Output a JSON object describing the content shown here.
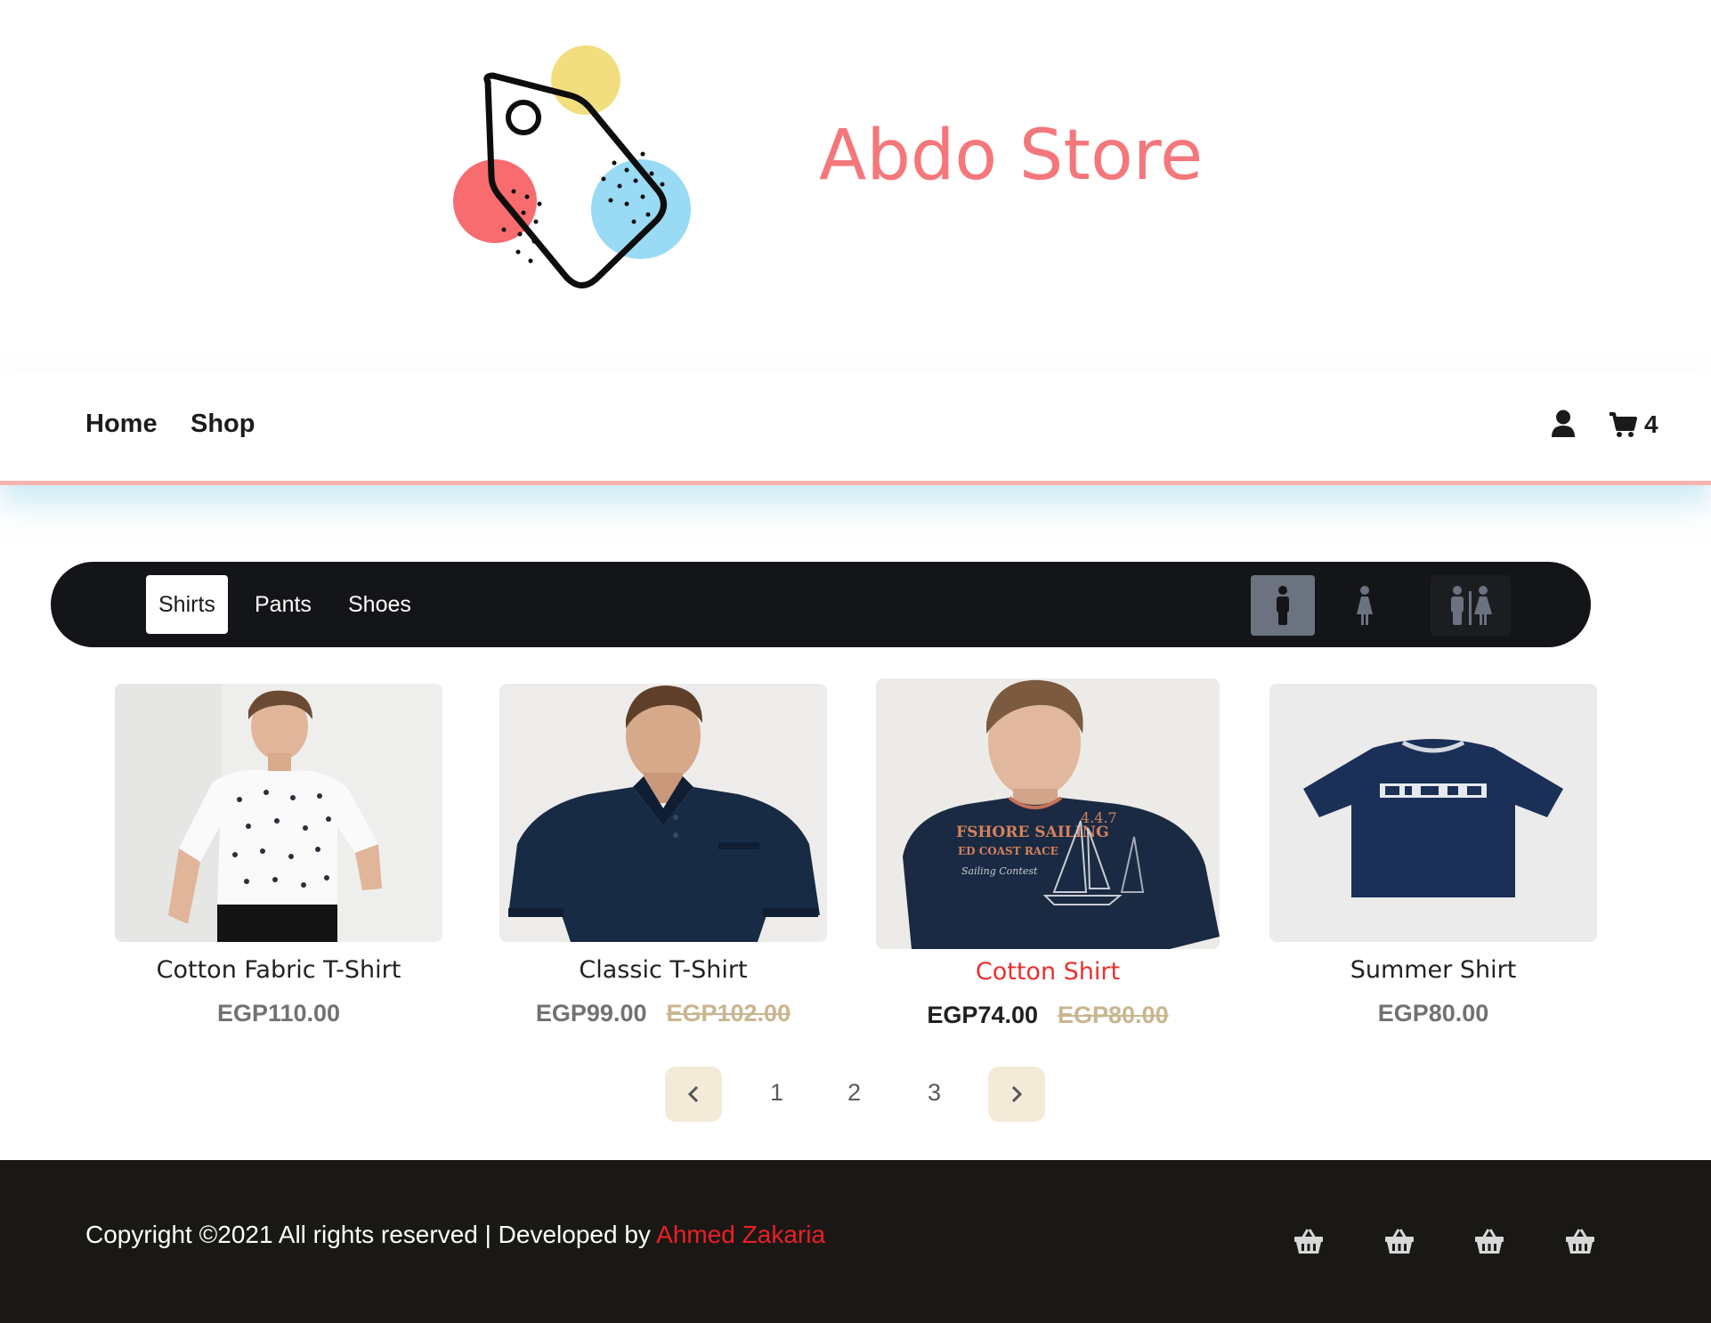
{
  "header": {
    "store_name": "Abdo Store",
    "logo_icon": "price-tag-logo"
  },
  "nav": {
    "links": [
      "Home",
      "Shop"
    ],
    "user_icon": "user-icon",
    "cart_icon": "shopping-cart-icon",
    "cart_count": "4"
  },
  "filters": {
    "categories": [
      "Shirts",
      "Pants",
      "Shoes"
    ],
    "active_category": "Shirts",
    "gender_icons": [
      "male-icon",
      "female-icon",
      "male-female-icon"
    ],
    "active_gender": "male-icon"
  },
  "products": [
    {
      "name": "Cotton Fabric T-Shirt",
      "price": "EGP110.00",
      "old_price": ""
    },
    {
      "name": "Classic T-Shirt",
      "price": "EGP99.00",
      "old_price": "EGP102.00"
    },
    {
      "name": "Cotton Shirt",
      "price": "EGP74.00",
      "old_price": "EGP80.00"
    },
    {
      "name": "Summer Shirt",
      "price": "EGP80.00",
      "old_price": ""
    }
  ],
  "pagination": {
    "pages": [
      "1",
      "2",
      "3"
    ],
    "prev_icon": "chevron-left-icon",
    "next_icon": "chevron-right-icon"
  },
  "footer": {
    "copyright": "Copyright ©2021 All rights reserved | Developed by ",
    "developer": "Ahmed Zakaria",
    "icons": [
      "basket-icon",
      "basket-icon",
      "basket-icon",
      "basket-icon"
    ]
  },
  "colors": {
    "brand": "#f4777b",
    "filter_bar": "#141518",
    "footer": "#1a1815",
    "accent_red": "#e8312d",
    "pager_bg": "#f3ead8"
  }
}
